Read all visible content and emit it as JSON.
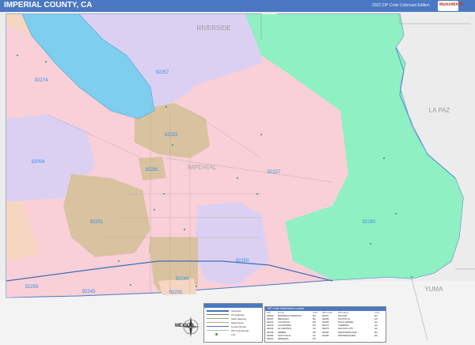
{
  "header": {
    "title": "IMPERIAL COUNTY, CA",
    "edition": "2022 ZIP Code Colorcast Edition",
    "logo_text": "MarketMAPS"
  },
  "map": {
    "neighbors": {
      "riverside": "RIVERSIDE",
      "la_paz": "LA PAZ",
      "yuma": "YUMA"
    },
    "county_label": "IMPERIAL",
    "zip_labels": {
      "z92274": "92274",
      "z92257": "92257",
      "z92233": "92233",
      "z92004": "92004",
      "z92281": "92281",
      "z92227": "92227",
      "z92283": "92283",
      "z92251": "92251",
      "z92250": "92250",
      "z92249": "92249",
      "z92259": "92259",
      "z92243": "92243",
      "z92231": "92231"
    },
    "country_label": "MEXICO",
    "colors": {
      "salton_sea": "#7ecfef",
      "green_zip": "#8ff0c3",
      "pink_zip": "#f9cfd8",
      "lavender_zip": "#dcd0f2",
      "tan_zip": "#d9c2a0",
      "peach_zip": "#f6d6c0",
      "outside_gray": "#ececec",
      "zip_label": "#2f8fe6",
      "county_border": "#4a78c2"
    }
  },
  "legend": {
    "items": [
      {
        "label": "Interstate"
      },
      {
        "label": "US Highway"
      },
      {
        "label": "State Highway"
      },
      {
        "label": "Major Road"
      },
      {
        "label": "County Border"
      },
      {
        "label": "ZIP Code Border"
      },
      {
        "label": "City"
      }
    ]
  },
  "zip_table": {
    "title": "ZIP Code Table/Index Locator",
    "columns": [
      "ZIP",
      "Name",
      "LOC",
      "ZIP Code",
      "ZIP Name",
      "LOC"
    ],
    "rows": [
      [
        "92004",
        "BORREGO SPRINGS",
        "B3",
        "92257",
        "NILAND",
        "D2"
      ],
      [
        "92227",
        "BRAWLEY",
        "E3",
        "92259",
        "OCOTILLO",
        "A6"
      ],
      [
        "92231",
        "CALEXICO",
        "D6",
        "92266",
        "PALO VERDE",
        "G2"
      ],
      [
        "92233",
        "CALIPATRIA",
        "D3",
        "92274",
        "THERMAL",
        "A2"
      ],
      [
        "92243",
        "EL CENTRO",
        "C6",
        "92275",
        "SALTON CITY",
        "A2"
      ],
      [
        "92249",
        "HEBER",
        "D6",
        "92281",
        "WESTMORLAND",
        "D4"
      ],
      [
        "92250",
        "HOLTVILLE",
        "F6",
        "92283",
        "WINTERHAVEN",
        "H6"
      ],
      [
        "92251",
        "IMPERIAL",
        "C5",
        "",
        "",
        ""
      ]
    ]
  },
  "compass": {
    "label": "MEXICO"
  }
}
